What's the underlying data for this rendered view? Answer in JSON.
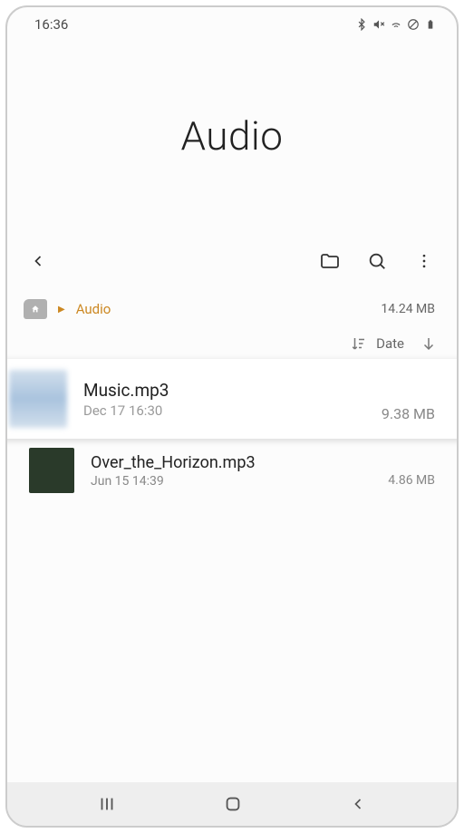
{
  "statusBar": {
    "time": "16:36"
  },
  "header": {
    "title": "Audio"
  },
  "breadcrumb": {
    "current": "Audio",
    "totalSize": "14.24 MB"
  },
  "sort": {
    "label": "Date"
  },
  "files": [
    {
      "name": "Music.mp3",
      "date": "Dec 17 16:30",
      "size": "9.38 MB"
    },
    {
      "name": "Over_the_Horizon.mp3",
      "date": "Jun 15 14:39",
      "size": "4.86 MB"
    }
  ]
}
